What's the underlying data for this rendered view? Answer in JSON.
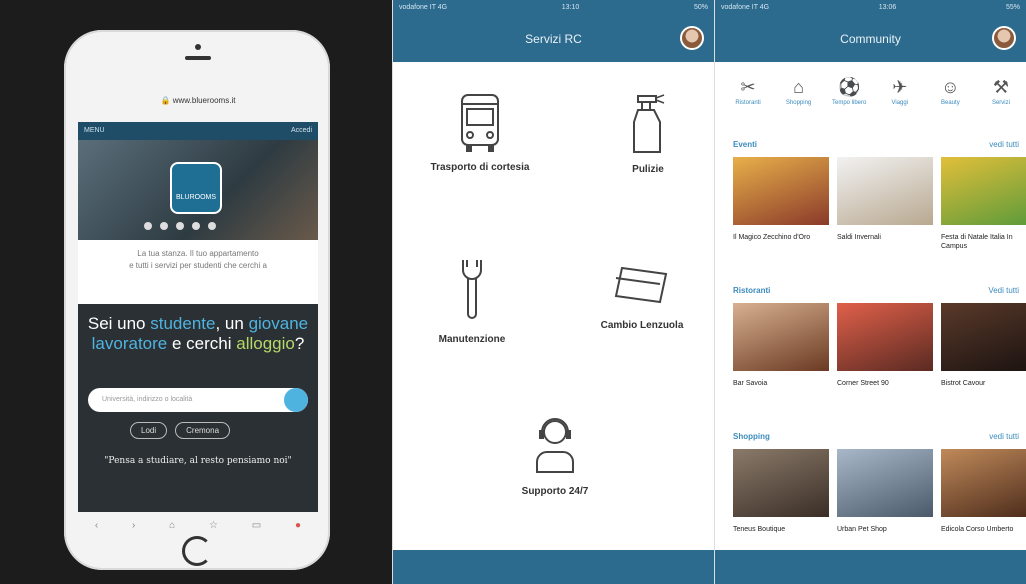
{
  "panel1": {
    "address_bar": "www.bluerooms.it",
    "top_strip_left": "MENU",
    "top_strip_right": "Accedi",
    "logo_text": "BLUROOMS",
    "intro_line1": "La tua stanza. Il tuo appartamento",
    "intro_line2": "e tutti i servizi per studenti che cerchi a",
    "question_part1": "Sei uno ",
    "question_student": "studente",
    "question_part2": ", un ",
    "question_worker": "giovane lavoratore",
    "question_part3": " e cerchi ",
    "question_housing": "alloggio",
    "question_part4": "?",
    "search_placeholder": "Università, indirizzo o località",
    "pill_1": "Lodi",
    "pill_2": "Cremona",
    "quote": "\"Pensa a studiare, al resto pensiamo noi\""
  },
  "panel2": {
    "status_carrier": "vodafone IT  4G",
    "status_time": "13:10",
    "status_battery": "50%",
    "title": "Servizi RC",
    "services": [
      {
        "label": "Trasporto di cortesia",
        "icon": "bus-icon"
      },
      {
        "label": "Pulizie",
        "icon": "spray-bottle-icon"
      },
      {
        "label": "Manutenzione",
        "icon": "wrench-icon"
      },
      {
        "label": "Cambio Lenzuola",
        "icon": "sheets-icon"
      },
      {
        "label": "Supporto 24/7",
        "icon": "support-agent-icon"
      }
    ],
    "accent": "#2c6a8e"
  },
  "panel3": {
    "status_carrier": "vodafone IT  4G",
    "status_time": "13:06",
    "status_battery": "55%",
    "title": "Community",
    "categories": [
      {
        "label": "Ristoranti",
        "icon": "cutlery-icon",
        "glyph": "✂"
      },
      {
        "label": "Shopping",
        "icon": "shopping-bag-icon",
        "glyph": "⌂"
      },
      {
        "label": "Tempo libero",
        "icon": "ball-icon",
        "glyph": "⚽"
      },
      {
        "label": "Viaggi",
        "icon": "plane-icon",
        "glyph": "✈"
      },
      {
        "label": "Beauty",
        "icon": "beauty-icon",
        "glyph": "☺"
      },
      {
        "label": "Servizi",
        "icon": "tools-icon",
        "glyph": "⚒"
      }
    ],
    "sections": [
      {
        "title": "Eventi",
        "action": "vedi tutti",
        "items": [
          {
            "caption": "Il Magico Zecchino d'Oro",
            "color": "#c98a3a"
          },
          {
            "caption": "Saldi Invernali",
            "color": "#d9d4cc"
          },
          {
            "caption": "Festa di Natale Italia In Campus",
            "color": "#6aa84f"
          }
        ]
      },
      {
        "title": "Ristoranti",
        "action": "Vedi tutti",
        "items": [
          {
            "caption": "Bar Savoia",
            "color": "#a0694a"
          },
          {
            "caption": "Corner Street 90",
            "color": "#b04a3a"
          },
          {
            "caption": "Bistrot Cavour",
            "color": "#3a2a22"
          }
        ]
      },
      {
        "title": "Shopping",
        "action": "vedi tutti",
        "items": [
          {
            "caption": "Teneus Boutique",
            "color": "#6b5a4a"
          },
          {
            "caption": "Urban Pet Shop",
            "color": "#7a8a9a"
          },
          {
            "caption": "Edicola Corso Umberto",
            "color": "#8a5a3a"
          }
        ]
      }
    ]
  }
}
